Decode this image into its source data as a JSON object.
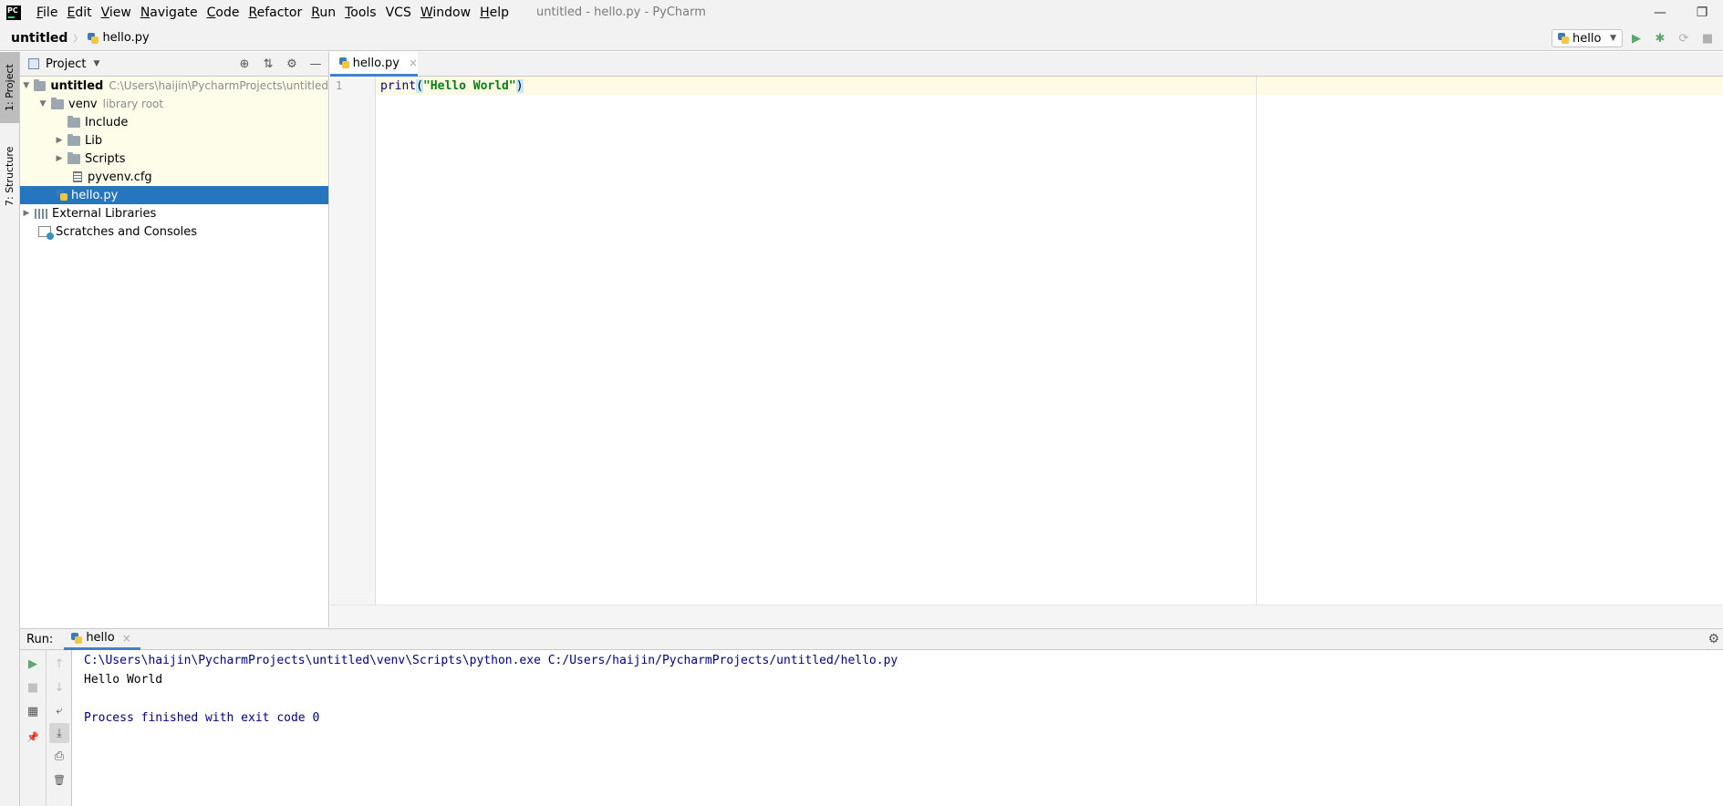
{
  "app": {
    "logo_text": "PC",
    "window_title": "untitled - hello.py - PyCharm",
    "menu": [
      {
        "mn": "F",
        "rest": "ile"
      },
      {
        "mn": "E",
        "rest": "dit"
      },
      {
        "mn": "V",
        "rest": "iew"
      },
      {
        "mn": "N",
        "rest": "avigate"
      },
      {
        "mn": "C",
        "rest": "ode"
      },
      {
        "mn": "R",
        "rest": "efactor"
      },
      {
        "mn": "R",
        "rest": "un"
      },
      {
        "mn": "T",
        "rest": "ools"
      },
      {
        "mn": "",
        "rest": "VCS"
      },
      {
        "mn": "W",
        "rest": "indow"
      },
      {
        "mn": "H",
        "rest": "elp"
      }
    ],
    "window_controls": {
      "minimize": "—",
      "restore": "❐"
    }
  },
  "navbar": {
    "project": "untitled",
    "separator": "〉",
    "file": "hello.py",
    "run_config": "hello",
    "run_config_chevron": "▼",
    "actions": {
      "run": "▶",
      "debug": "✱",
      "coverage": "⟳",
      "stop": "■"
    }
  },
  "left_strip": {
    "project_tab": "1: Project",
    "structure_tab": "7: Structure"
  },
  "project_panel": {
    "title": "Project",
    "chevron": "▼",
    "tools": {
      "locate": "⊕",
      "collapse": "⇅",
      "settings": "⚙",
      "hide": "—"
    },
    "tree": {
      "root": {
        "name": "untitled",
        "path": "C:\\Users\\haijin\\PycharmProjects\\untitled",
        "arrow": "▼"
      },
      "venv": {
        "name": "venv",
        "hint": "library root",
        "arrow": "▼"
      },
      "include": {
        "name": "Include"
      },
      "lib": {
        "name": "Lib",
        "arrow": "▶"
      },
      "scripts": {
        "name": "Scripts",
        "arrow": "▶"
      },
      "pyvenv": {
        "name": "pyvenv.cfg"
      },
      "hello": {
        "name": "hello.py"
      },
      "external": {
        "name": "External Libraries",
        "arrow": "▶"
      },
      "scratches": {
        "name": "Scratches and Consoles"
      }
    }
  },
  "editor": {
    "tab_label": "hello.py",
    "tab_close": "×",
    "line_number": "1",
    "code": {
      "func": "print",
      "open": "(",
      "string": "\"Hello World\"",
      "close": ")"
    }
  },
  "run_panel": {
    "label": "Run:",
    "tab": "hello",
    "tab_close": "×",
    "gear": "⚙",
    "tools": {
      "rerun": "▶",
      "stop": "■",
      "layout": "▦",
      "pin": "📌",
      "up": "↑",
      "down": "↓",
      "wrap": "⤶",
      "scroll_end": "⤓",
      "print": "⎙",
      "clear": "🗑"
    },
    "console": {
      "command": "C:\\Users\\haijin\\PycharmProjects\\untitled\\venv\\Scripts\\python.exe C:/Users/haijin/PycharmProjects/untitled/hello.py",
      "output": "Hello World",
      "exit": "Process finished with exit code 0"
    }
  }
}
